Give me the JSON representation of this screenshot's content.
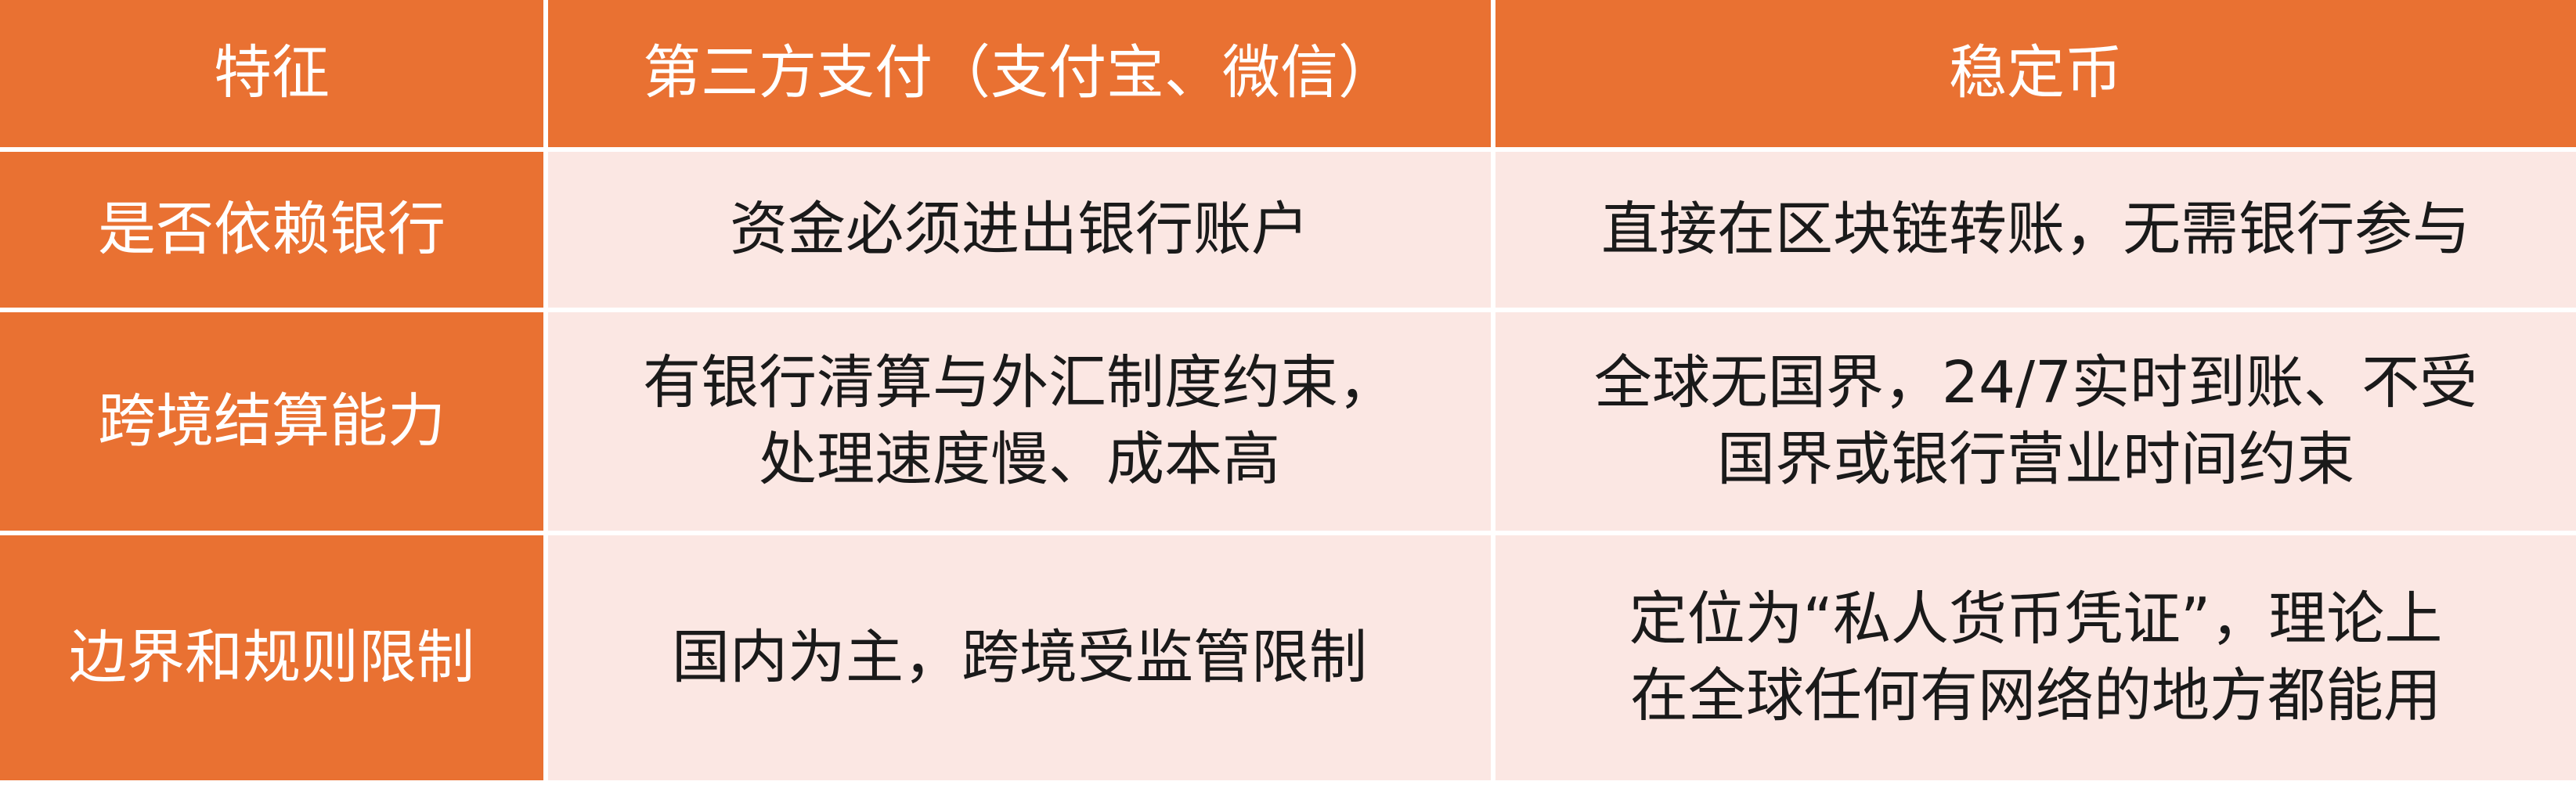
{
  "table": {
    "headers": [
      "特征",
      "第三方支付（支付宝、微信）",
      "稳定币"
    ],
    "rows": [
      {
        "feature": "是否依赖银行",
        "third_party": [
          "资金必须进出银行账户"
        ],
        "stablecoin": [
          "直接在区块链转账，无需银行参与"
        ]
      },
      {
        "feature": "跨境结算能力",
        "third_party": [
          "有银行清算与外汇制度约束，",
          "处理速度慢、成本高"
        ],
        "stablecoin": [
          "全球无国界，24/7实时到账、不受",
          "国界或银行营业时间约束"
        ]
      },
      {
        "feature": "边界和规则限制",
        "third_party": [
          "国内为主，跨境受监管限制"
        ],
        "stablecoin": [
          "定位为“私人货币凭证”，理论上",
          "在全球任何有网络的地方都能用"
        ]
      }
    ]
  },
  "colors": {
    "header_bg": "#e97132",
    "body_bg": "#fbe7e3",
    "header_text": "#ffffff",
    "body_text": "#1a1a1a"
  }
}
